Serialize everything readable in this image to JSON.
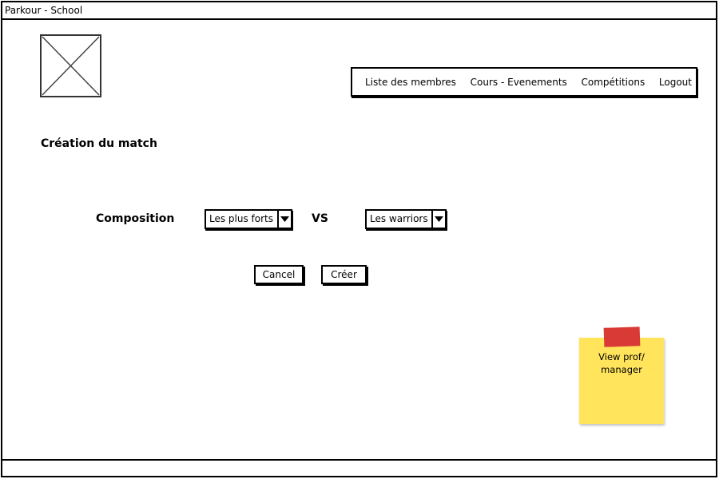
{
  "window": {
    "title": "Parkour - School"
  },
  "nav": {
    "items": [
      {
        "label": "Liste des membres"
      },
      {
        "label": "Cours - Evenements"
      },
      {
        "label": "Compétitions"
      },
      {
        "label": "Logout"
      }
    ]
  },
  "page": {
    "title": "Création du match"
  },
  "form": {
    "composition_label": "Composition",
    "vs_label": "VS",
    "team_a": {
      "selected": "Les plus forts"
    },
    "team_b": {
      "selected": "Les warriors"
    },
    "cancel_label": "Cancel",
    "create_label": "Créer"
  },
  "sticky_note": {
    "text": "View prof/\nmanager",
    "color": "#ffe45c",
    "tape_color": "#d93a35"
  },
  "icons": {
    "logo": "image-placeholder-icon",
    "dropdown": "chevron-down-icon"
  }
}
